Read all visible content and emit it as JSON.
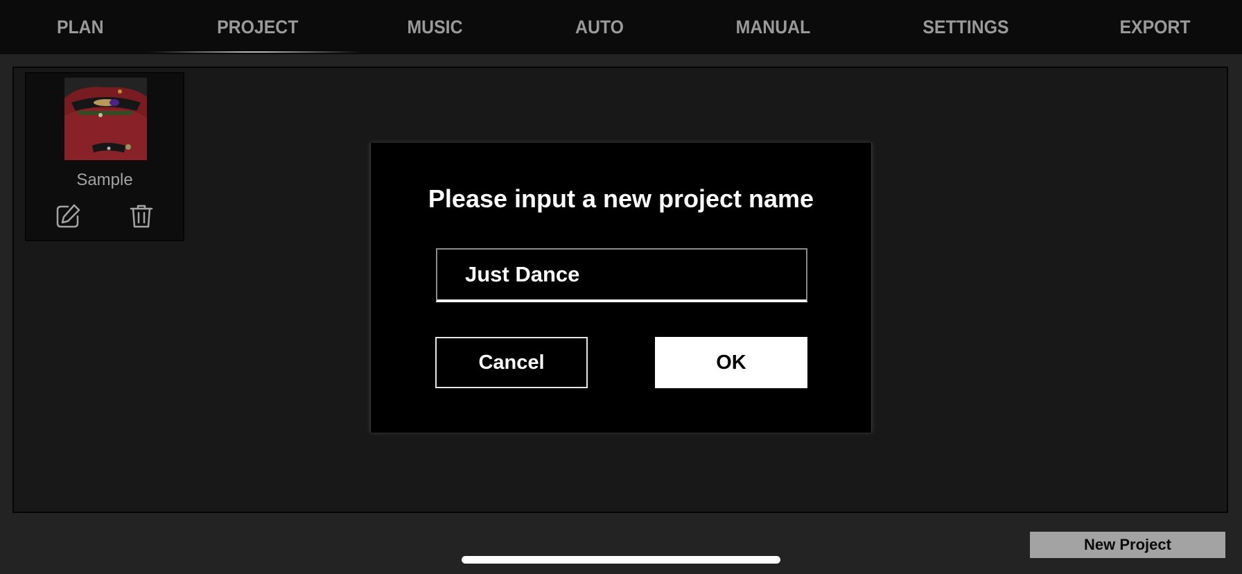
{
  "nav": {
    "tabs": [
      {
        "label": "PLAN"
      },
      {
        "label": "PROJECT",
        "active": true
      },
      {
        "label": "MUSIC"
      },
      {
        "label": "AUTO"
      },
      {
        "label": "MANUAL"
      },
      {
        "label": "SETTINGS"
      },
      {
        "label": "EXPORT"
      }
    ]
  },
  "projects": [
    {
      "name": "Sample",
      "edit_icon": "edit-icon",
      "delete_icon": "trash-icon"
    }
  ],
  "dialog": {
    "title": "Please input a new project name",
    "input_value": "Just Dance",
    "cancel_label": "Cancel",
    "ok_label": "OK"
  },
  "footer": {
    "new_project_label": "New Project"
  },
  "colors": {
    "background": "#232323",
    "nav_background": "#0b0b0b",
    "tab_text": "#9a9a9a",
    "modal_background": "#000000",
    "new_project_button": "#a3a3a3"
  }
}
